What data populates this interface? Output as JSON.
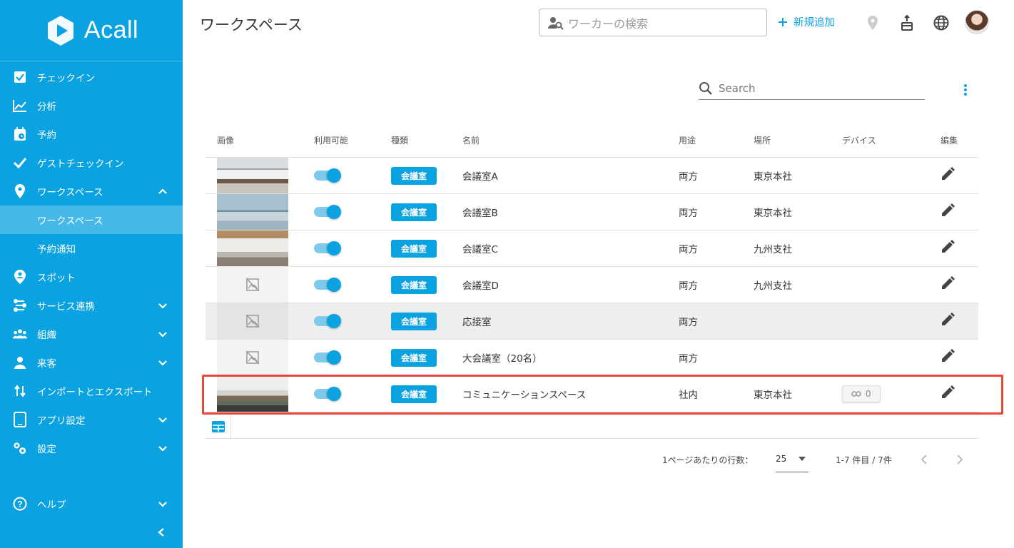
{
  "sidebar": {
    "logo_text": "Acall",
    "items": [
      {
        "label": "チェックイン",
        "icon": "checkbox-icon"
      },
      {
        "label": "分析",
        "icon": "chart-icon"
      },
      {
        "label": "予約",
        "icon": "calendar-icon"
      },
      {
        "label": "ゲストチェックイン",
        "icon": "check-icon"
      },
      {
        "label": "ワークスペース",
        "icon": "location-pin-icon"
      },
      {
        "label": "ワークスペース"
      },
      {
        "label": "予約通知"
      },
      {
        "label": "スポット",
        "icon": "person-pin-icon"
      },
      {
        "label": "サービス連携",
        "icon": "integration-icon"
      },
      {
        "label": "組織",
        "icon": "group-icon"
      },
      {
        "label": "来客",
        "icon": "visitor-icon"
      },
      {
        "label": "インポートとエクスポート",
        "icon": "import-export-icon"
      },
      {
        "label": "アプリ設定",
        "icon": "tablet-icon"
      },
      {
        "label": "設定",
        "icon": "gears-icon"
      }
    ],
    "help_label": "ヘルプ"
  },
  "header": {
    "title": "ワークスペース",
    "worker_search_placeholder": "ワーカーの検索",
    "add_new_label": "新規追加"
  },
  "search": {
    "placeholder": "Search"
  },
  "table": {
    "columns": [
      "画像",
      "利用可能",
      "種類",
      "名前",
      "用途",
      "場所",
      "デバイス",
      "編集"
    ],
    "rows": [
      {
        "type": "会議室",
        "name": "会議室A",
        "use": "両方",
        "place": "東京本社",
        "has_image": true,
        "available": true
      },
      {
        "type": "会議室",
        "name": "会議室B",
        "use": "両方",
        "place": "東京本社",
        "has_image": true,
        "available": true
      },
      {
        "type": "会議室",
        "name": "会議室C",
        "use": "両方",
        "place": "九州支社",
        "has_image": true,
        "available": true
      },
      {
        "type": "会議室",
        "name": "会議室D",
        "use": "両方",
        "place": "九州支社",
        "has_image": false,
        "available": true
      },
      {
        "type": "会議室",
        "name": "応接室",
        "use": "両方",
        "place": "",
        "has_image": false,
        "available": true
      },
      {
        "type": "会議室",
        "name": "大会議室（20名）",
        "use": "両方",
        "place": "",
        "has_image": false,
        "available": true
      },
      {
        "type": "会議室",
        "name": "コミュニケーションスペース",
        "use": "社内",
        "place": "東京本社",
        "has_image": true,
        "available": true,
        "device_count": "0"
      }
    ]
  },
  "pagination": {
    "rows_per_page_label": "1ページあたりの行数：",
    "rows_per_page": "25",
    "range_label": "1-7 件目 / 7件"
  },
  "colors": {
    "accent": "#0aa2e0",
    "highlight": "#e8453c"
  }
}
